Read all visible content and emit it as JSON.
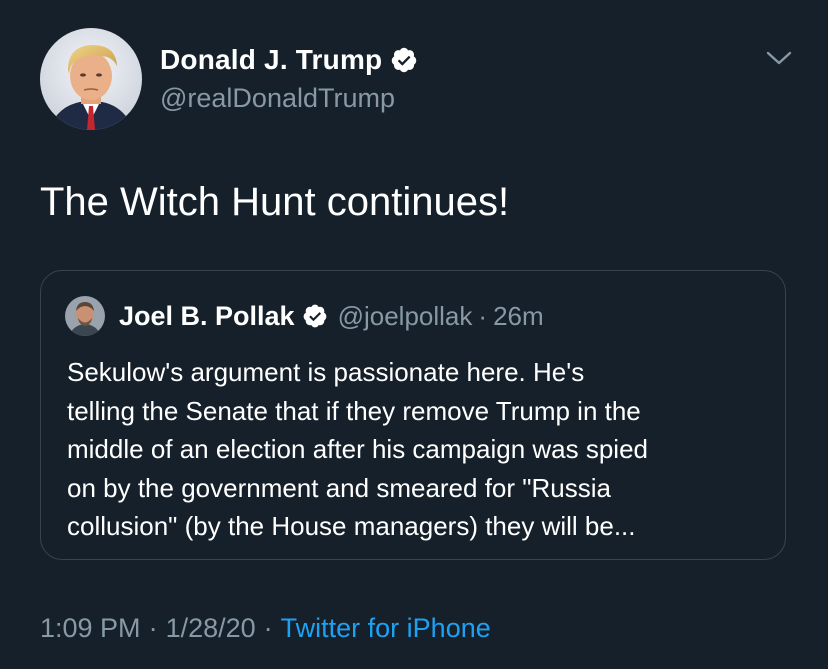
{
  "author": {
    "display_name": "Donald J. Trump",
    "handle": "@realDonaldTrump",
    "verified_icon": "verified-badge-icon",
    "avatar_icon": "profile-avatar"
  },
  "menu": {
    "icon": "chevron-down-icon"
  },
  "tweet": {
    "text": "The Witch Hunt continues!"
  },
  "quote": {
    "display_name": "Joel B. Pollak",
    "handle": "@joelpollak",
    "separator": "·",
    "time": "26m",
    "text_lines": [
      "Sekulow's argument is passionate here. He's",
      "telling the Senate that if they remove Trump in the",
      "middle of an election after his campaign was spied",
      "on by the government and smeared for \"Russia",
      "collusion\" (by the House managers) they will be..."
    ]
  },
  "meta": {
    "time": "1:09 PM",
    "separator": "·",
    "date": "1/28/20",
    "source": "Twitter for iPhone"
  },
  "colors": {
    "background": "#15202b",
    "secondary_text": "#8899a6",
    "link": "#1da1f2",
    "border": "#38444d"
  }
}
